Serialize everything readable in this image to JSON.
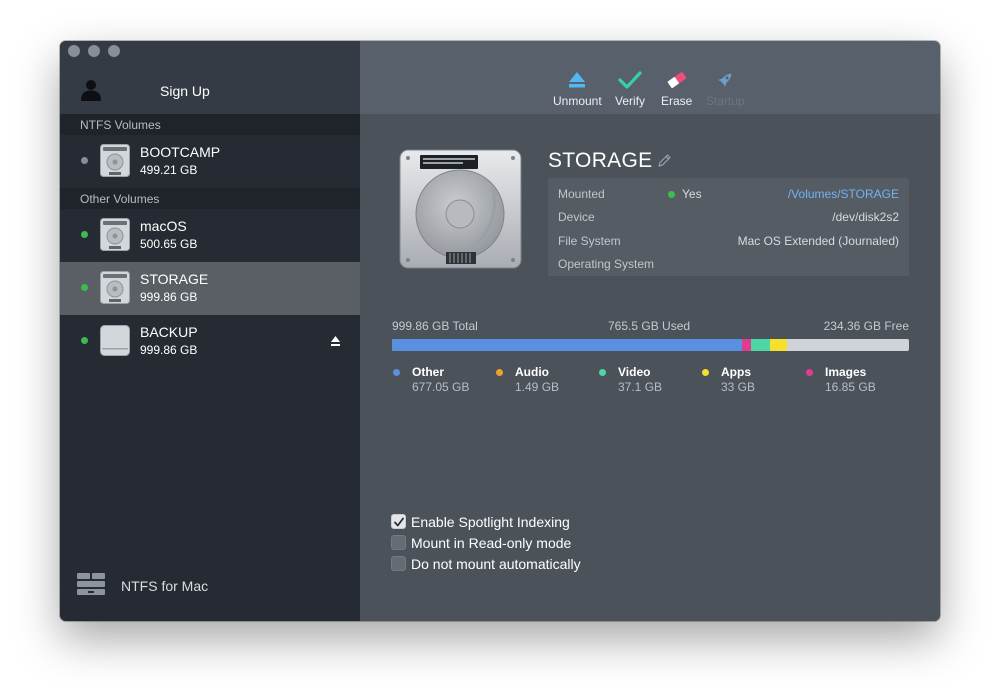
{
  "window": {
    "traffic_lights": [
      "close",
      "minimize",
      "zoom"
    ]
  },
  "sidebar": {
    "account_icon": "user-icon",
    "signup_label": "Sign Up",
    "sections": [
      {
        "label": "NTFS Volumes",
        "volumes": [
          {
            "name": "BOOTCAMP",
            "size": "499.21 GB",
            "status_color": "#8a8f96",
            "selected": false,
            "ejectable": false
          }
        ]
      },
      {
        "label": "Other Volumes",
        "volumes": [
          {
            "name": "macOS",
            "size": "500.65 GB",
            "status_color": "#3dbb4f",
            "selected": false,
            "ejectable": false
          },
          {
            "name": "STORAGE",
            "size": "999.86 GB",
            "status_color": "#3dbb4f",
            "selected": true,
            "ejectable": false
          },
          {
            "name": "BACKUP",
            "size": "999.86 GB",
            "status_color": "#3dbb4f",
            "selected": false,
            "ejectable": true
          }
        ]
      }
    ],
    "footer": {
      "brand": "NTFS for Mac",
      "icon": "ntfs-logo-icon"
    }
  },
  "toolbar": {
    "unmount": "Unmount",
    "verify": "Verify",
    "erase": "Erase",
    "startup": "Startup"
  },
  "volume": {
    "title": "STORAGE",
    "info": {
      "mounted_label": "Mounted",
      "mounted_value": "Yes",
      "mounted_color": "#3dbb4f",
      "mount_path": "/Volumes/STORAGE",
      "device_label": "Device",
      "device_value": "/dev/disk2s2",
      "fs_label": "File System",
      "fs_value": "Mac OS Extended (Journaled)",
      "os_label": "Operating System",
      "os_value": ""
    },
    "usage": {
      "total": "999.86 GB Total",
      "used": "765.5 GB Used",
      "free": "234.36 GB Free",
      "total_gb": 999.86,
      "segments": [
        {
          "name": "Other",
          "size": "677.05 GB",
          "gb": 677.05,
          "color": "#5b8fe0"
        },
        {
          "name": "Audio",
          "size": "1.49 GB",
          "gb": 1.49,
          "color": "#f0a22c"
        },
        {
          "name": "Video",
          "size": "37.1 GB",
          "gb": 37.1,
          "color": "#4fd6a5"
        },
        {
          "name": "Apps",
          "size": "33 GB",
          "gb": 33,
          "color": "#f5e02c"
        },
        {
          "name": "Images",
          "size": "16.85 GB",
          "gb": 16.85,
          "color": "#e03d8f"
        }
      ],
      "bar_order": [
        "Other",
        "Images",
        "Video",
        "Apps"
      ]
    },
    "options": [
      {
        "label": "Enable Spotlight Indexing",
        "checked": true
      },
      {
        "label": "Mount in Read-only mode",
        "checked": false
      },
      {
        "label": "Do not mount automatically",
        "checked": false
      }
    ]
  }
}
